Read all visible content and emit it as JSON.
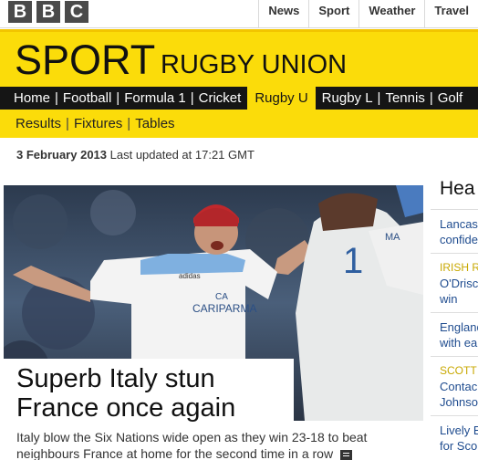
{
  "header": {
    "logo_letters": [
      "B",
      "B",
      "C"
    ],
    "topnav": [
      "News",
      "Sport",
      "Weather",
      "Travel"
    ]
  },
  "banner": {
    "sport": "SPORT",
    "section": "RUGBY UNION"
  },
  "mainnav": {
    "items": [
      "Home",
      "Football",
      "Formula 1",
      "Cricket",
      "Rugby U",
      "Rugby L",
      "Tennis",
      "Golf"
    ],
    "active": "Rugby U"
  },
  "subnav": {
    "items": [
      "Results",
      "Fixtures",
      "Tables"
    ]
  },
  "dateline": {
    "date": "3 February 2013",
    "updated": "Last updated at 17:21 GMT"
  },
  "story": {
    "headline_line1": "Superb Italy stun",
    "headline_line2": "France once again",
    "summary": "Italy blow the Six Nations wide open as they win 23-18 to beat neighbours France at home for the second time in a row",
    "shirt_text_1": "CARIPARMA",
    "shirt_text_2": "CA",
    "shirt_text_3": "adidas",
    "shirt_text_4": "MA",
    "back_number": "1"
  },
  "rightcol": {
    "title": "Hea",
    "items": [
      {
        "tag": "",
        "lines": [
          "Lancas",
          "confide"
        ]
      },
      {
        "tag": "IRISH R",
        "lines": [
          "O'Drisc",
          "win"
        ]
      },
      {
        "tag": "",
        "lines": [
          "England",
          "with ea"
        ]
      },
      {
        "tag": "SCOTT",
        "lines": [
          "Contac",
          "Johnso"
        ]
      },
      {
        "tag": "",
        "lines": [
          "Lively E",
          "for Sco"
        ]
      }
    ]
  },
  "colors": {
    "sport_yellow": "#fbdc0a",
    "nav_black": "#151515",
    "link_blue": "#1f4c8f"
  }
}
